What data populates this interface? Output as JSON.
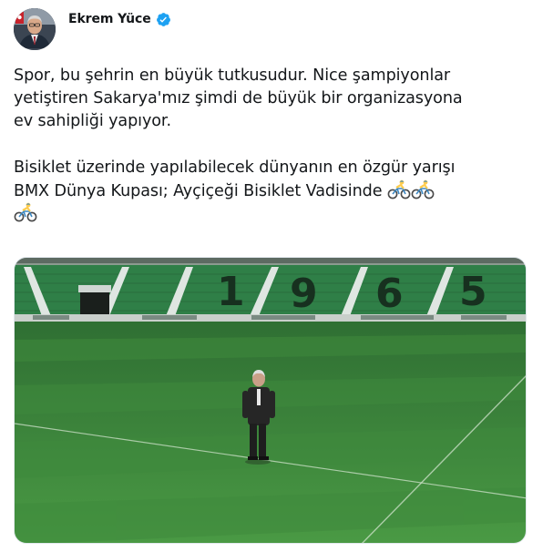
{
  "author": {
    "name": "Ekrem Yüce",
    "avatar_icon": "profile-photo",
    "verified_icon": "verified-badge-icon",
    "verified_color": "#1da1f2"
  },
  "tweet": {
    "line1": "Spor, bu şehrin en büyük tutkusudur. Nice şampiyonlar",
    "line2": "yetiştiren Sakarya'mız şimdi de büyük bir organizasyona",
    "line3": "ev sahipliği yapıyor.",
    "line4": "Bisiklet üzerinde yapılabilecek dünyanın en özgür yarışı",
    "line5": "BMX Dünya Kupası; Ayçiçeği Bisiklet Vadisinde",
    "emoji_icon": "person-biking-emoji"
  },
  "media": {
    "type": "photo",
    "seat_digits": [
      "1",
      "9",
      "6",
      "5"
    ],
    "colors": {
      "grass": "#3d8a3a",
      "seats": "#2f7f47",
      "digits": "#17301f"
    }
  }
}
